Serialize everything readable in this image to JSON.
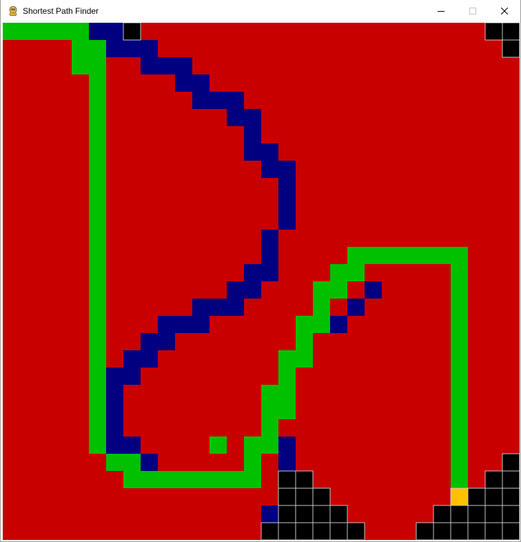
{
  "window": {
    "title": "Shortest Path Finder",
    "icon": "pygame-snake-icon",
    "controls": [
      "minimize-icon",
      "maximize-icon",
      "close-icon"
    ]
  },
  "colors": {
    "background": "#c80000",
    "path": "#00c000",
    "visited": "#000080",
    "wall": "#000000",
    "wall_outline": "#c8c8c8",
    "end": "#ffc000"
  },
  "grid": {
    "columns": 30,
    "rows": 30,
    "path": [
      [
        0,
        0
      ],
      [
        1,
        0
      ],
      [
        2,
        0
      ],
      [
        3,
        0
      ],
      [
        4,
        0
      ],
      [
        4,
        1
      ],
      [
        5,
        1
      ],
      [
        5,
        2
      ],
      [
        5,
        3
      ],
      [
        5,
        4
      ],
      [
        5,
        5
      ],
      [
        5,
        6
      ],
      [
        5,
        7
      ],
      [
        5,
        8
      ],
      [
        5,
        9
      ],
      [
        5,
        10
      ],
      [
        5,
        11
      ],
      [
        5,
        12
      ],
      [
        5,
        13
      ],
      [
        5,
        14
      ],
      [
        5,
        15
      ],
      [
        5,
        16
      ],
      [
        5,
        17
      ],
      [
        5,
        18
      ],
      [
        5,
        19
      ],
      [
        5,
        20
      ],
      [
        5,
        21
      ],
      [
        5,
        22
      ],
      [
        5,
        23
      ],
      [
        5,
        24
      ],
      [
        6,
        25
      ],
      [
        7,
        25
      ],
      [
        7,
        26
      ],
      [
        8,
        26
      ],
      [
        9,
        26
      ],
      [
        10,
        26
      ],
      [
        11,
        26
      ],
      [
        12,
        26
      ],
      [
        13,
        26
      ],
      [
        14,
        26
      ],
      [
        14,
        25
      ],
      [
        14,
        24
      ],
      [
        15,
        24
      ],
      [
        15,
        23
      ],
      [
        15,
        22
      ],
      [
        16,
        22
      ],
      [
        16,
        21
      ],
      [
        16,
        20
      ],
      [
        16,
        19
      ],
      [
        17,
        19
      ],
      [
        17,
        18
      ],
      [
        17,
        17
      ],
      [
        18,
        17
      ],
      [
        18,
        16
      ],
      [
        18,
        15
      ],
      [
        19,
        15
      ],
      [
        19,
        14
      ],
      [
        20,
        14
      ],
      [
        20,
        13
      ],
      [
        21,
        13
      ],
      [
        22,
        13
      ],
      [
        23,
        13
      ],
      [
        24,
        13
      ],
      [
        25,
        13
      ],
      [
        26,
        13
      ],
      [
        26,
        14
      ],
      [
        26,
        15
      ],
      [
        26,
        16
      ],
      [
        26,
        17
      ],
      [
        26,
        18
      ],
      [
        26,
        19
      ],
      [
        26,
        20
      ],
      [
        26,
        21
      ],
      [
        26,
        22
      ],
      [
        26,
        23
      ],
      [
        26,
        24
      ],
      [
        26,
        25
      ],
      [
        26,
        26
      ],
      [
        4,
        2
      ],
      [
        12,
        24
      ],
      [
        7,
        26
      ],
      [
        15,
        21
      ]
    ],
    "visited": [
      [
        5,
        0
      ],
      [
        6,
        0
      ],
      [
        6,
        1
      ],
      [
        7,
        1
      ],
      [
        8,
        1
      ],
      [
        8,
        2
      ],
      [
        9,
        2
      ],
      [
        10,
        2
      ],
      [
        10,
        3
      ],
      [
        11,
        3
      ],
      [
        11,
        4
      ],
      [
        12,
        4
      ],
      [
        13,
        4
      ],
      [
        13,
        5
      ],
      [
        14,
        5
      ],
      [
        14,
        6
      ],
      [
        14,
        7
      ],
      [
        15,
        7
      ],
      [
        15,
        8
      ],
      [
        16,
        8
      ],
      [
        16,
        9
      ],
      [
        16,
        10
      ],
      [
        16,
        11
      ],
      [
        15,
        12
      ],
      [
        15,
        13
      ],
      [
        15,
        14
      ],
      [
        14,
        14
      ],
      [
        14,
        15
      ],
      [
        13,
        15
      ],
      [
        13,
        16
      ],
      [
        12,
        16
      ],
      [
        11,
        16
      ],
      [
        11,
        17
      ],
      [
        10,
        17
      ],
      [
        9,
        17
      ],
      [
        9,
        18
      ],
      [
        8,
        18
      ],
      [
        8,
        19
      ],
      [
        7,
        19
      ],
      [
        7,
        20
      ],
      [
        6,
        20
      ],
      [
        6,
        21
      ],
      [
        6,
        22
      ],
      [
        6,
        23
      ],
      [
        6,
        24
      ],
      [
        7,
        24
      ],
      [
        7,
        25
      ],
      [
        8,
        25
      ],
      [
        8,
        26
      ],
      [
        9,
        26
      ],
      [
        16,
        24
      ],
      [
        16,
        25
      ],
      [
        16,
        26
      ],
      [
        16,
        27
      ],
      [
        16,
        28
      ],
      [
        15,
        28
      ],
      [
        15,
        29
      ],
      [
        17,
        23
      ],
      [
        17,
        24
      ],
      [
        17,
        25
      ],
      [
        17,
        26
      ],
      [
        18,
        22
      ],
      [
        18,
        23
      ],
      [
        18,
        24
      ],
      [
        18,
        25
      ],
      [
        18,
        26
      ],
      [
        18,
        27
      ],
      [
        19,
        21
      ],
      [
        19,
        22
      ],
      [
        19,
        23
      ],
      [
        19,
        24
      ],
      [
        19,
        25
      ],
      [
        19,
        26
      ],
      [
        19,
        27
      ],
      [
        19,
        28
      ],
      [
        20,
        20
      ],
      [
        20,
        21
      ],
      [
        20,
        22
      ],
      [
        20,
        23
      ],
      [
        20,
        24
      ],
      [
        20,
        25
      ],
      [
        20,
        26
      ],
      [
        20,
        27
      ],
      [
        20,
        28
      ],
      [
        20,
        29
      ],
      [
        21,
        15
      ],
      [
        21,
        16
      ],
      [
        21,
        17
      ],
      [
        21,
        18
      ],
      [
        21,
        19
      ],
      [
        21,
        20
      ],
      [
        21,
        21
      ],
      [
        21,
        22
      ],
      [
        21,
        23
      ],
      [
        21,
        24
      ],
      [
        21,
        25
      ],
      [
        21,
        26
      ],
      [
        21,
        27
      ],
      [
        21,
        28
      ],
      [
        21,
        29
      ],
      [
        22,
        15
      ],
      [
        22,
        16
      ],
      [
        22,
        17
      ],
      [
        22,
        18
      ],
      [
        22,
        19
      ],
      [
        22,
        20
      ],
      [
        22,
        21
      ],
      [
        22,
        22
      ],
      [
        22,
        23
      ],
      [
        22,
        24
      ],
      [
        22,
        25
      ],
      [
        22,
        26
      ],
      [
        22,
        27
      ],
      [
        22,
        28
      ],
      [
        22,
        29
      ],
      [
        23,
        14
      ],
      [
        23,
        15
      ],
      [
        23,
        16
      ],
      [
        23,
        17
      ],
      [
        23,
        18
      ],
      [
        23,
        19
      ],
      [
        23,
        20
      ],
      [
        23,
        21
      ],
      [
        23,
        22
      ],
      [
        23,
        23
      ],
      [
        23,
        24
      ],
      [
        23,
        25
      ],
      [
        23,
        26
      ],
      [
        23,
        27
      ],
      [
        23,
        28
      ],
      [
        23,
        29
      ],
      [
        24,
        14
      ],
      [
        24,
        15
      ],
      [
        24,
        16
      ],
      [
        24,
        17
      ],
      [
        24,
        18
      ],
      [
        24,
        19
      ],
      [
        24,
        20
      ],
      [
        24,
        21
      ],
      [
        24,
        22
      ],
      [
        24,
        23
      ],
      [
        24,
        24
      ],
      [
        24,
        25
      ],
      [
        24,
        26
      ],
      [
        24,
        27
      ],
      [
        24,
        28
      ],
      [
        24,
        29
      ],
      [
        25,
        14
      ],
      [
        25,
        15
      ],
      [
        25,
        16
      ],
      [
        25,
        17
      ],
      [
        25,
        18
      ],
      [
        25,
        19
      ],
      [
        25,
        20
      ],
      [
        25,
        21
      ],
      [
        25,
        22
      ],
      [
        25,
        23
      ],
      [
        25,
        24
      ],
      [
        25,
        25
      ],
      [
        25,
        26
      ],
      [
        25,
        27
      ],
      [
        25,
        28
      ],
      [
        25,
        29
      ]
    ],
    "visited_trim": [
      [
        21,
        15
      ],
      [
        21,
        16
      ],
      [
        21,
        17
      ],
      [
        21,
        18
      ],
      [
        21,
        19
      ],
      [
        21,
        20
      ],
      [
        21,
        21
      ],
      [
        21,
        22
      ],
      [
        21,
        23
      ],
      [
        21,
        24
      ],
      [
        21,
        25
      ],
      [
        21,
        26
      ],
      [
        21,
        27
      ],
      [
        21,
        28
      ],
      [
        21,
        29
      ],
      [
        22,
        15
      ],
      [
        22,
        16
      ],
      [
        22,
        17
      ],
      [
        22,
        18
      ],
      [
        22,
        19
      ],
      [
        22,
        20
      ],
      [
        22,
        21
      ],
      [
        22,
        22
      ],
      [
        22,
        23
      ],
      [
        22,
        24
      ],
      [
        22,
        25
      ],
      [
        22,
        26
      ],
      [
        22,
        27
      ],
      [
        22,
        28
      ],
      [
        22,
        29
      ],
      [
        23,
        14
      ],
      [
        23,
        15
      ],
      [
        23,
        16
      ],
      [
        23,
        17
      ],
      [
        23,
        18
      ],
      [
        23,
        19
      ],
      [
        23,
        20
      ],
      [
        23,
        21
      ],
      [
        23,
        22
      ],
      [
        23,
        23
      ],
      [
        23,
        24
      ],
      [
        23,
        25
      ],
      [
        23,
        26
      ],
      [
        23,
        27
      ],
      [
        23,
        28
      ],
      [
        23,
        29
      ],
      [
        24,
        14
      ],
      [
        24,
        15
      ],
      [
        24,
        16
      ],
      [
        24,
        17
      ],
      [
        24,
        18
      ],
      [
        24,
        19
      ],
      [
        24,
        20
      ],
      [
        24,
        21
      ],
      [
        24,
        22
      ],
      [
        24,
        23
      ],
      [
        24,
        24
      ],
      [
        24,
        25
      ],
      [
        24,
        26
      ],
      [
        24,
        27
      ],
      [
        24,
        28
      ],
      [
        24,
        29
      ],
      [
        25,
        14
      ],
      [
        25,
        15
      ],
      [
        25,
        16
      ],
      [
        25,
        17
      ],
      [
        25,
        18
      ],
      [
        25,
        19
      ],
      [
        25,
        20
      ],
      [
        25,
        21
      ],
      [
        25,
        22
      ],
      [
        25,
        23
      ],
      [
        25,
        24
      ],
      [
        25,
        25
      ],
      [
        25,
        26
      ],
      [
        25,
        27
      ],
      [
        25,
        28
      ],
      [
        25,
        29
      ],
      [
        18,
        22
      ],
      [
        18,
        23
      ],
      [
        18,
        24
      ],
      [
        18,
        25
      ],
      [
        18,
        26
      ],
      [
        18,
        27
      ],
      [
        19,
        21
      ],
      [
        19,
        22
      ],
      [
        19,
        23
      ],
      [
        19,
        24
      ],
      [
        19,
        25
      ],
      [
        19,
        26
      ],
      [
        19,
        27
      ],
      [
        19,
        28
      ],
      [
        20,
        20
      ],
      [
        20,
        21
      ],
      [
        20,
        22
      ],
      [
        20,
        23
      ],
      [
        20,
        24
      ],
      [
        20,
        25
      ],
      [
        20,
        26
      ],
      [
        20,
        27
      ],
      [
        20,
        28
      ],
      [
        20,
        29
      ],
      [
        17,
        23
      ],
      [
        17,
        24
      ],
      [
        17,
        25
      ],
      [
        17,
        26
      ]
    ],
    "visited_diag": [
      [
        19,
        17
      ],
      [
        20,
        16
      ],
      [
        21,
        15
      ]
    ],
    "walls": [
      [
        7,
        0
      ],
      [
        28,
        0
      ],
      [
        29,
        0
      ],
      [
        29,
        1
      ],
      [
        16,
        26
      ],
      [
        17,
        26
      ],
      [
        16,
        27
      ],
      [
        17,
        27
      ],
      [
        18,
        27
      ],
      [
        16,
        28
      ],
      [
        17,
        28
      ],
      [
        18,
        28
      ],
      [
        19,
        28
      ],
      [
        15,
        29
      ],
      [
        16,
        29
      ],
      [
        17,
        29
      ],
      [
        18,
        29
      ],
      [
        19,
        29
      ],
      [
        20,
        29
      ],
      [
        29,
        25
      ],
      [
        28,
        26
      ],
      [
        29,
        26
      ],
      [
        27,
        27
      ],
      [
        28,
        27
      ],
      [
        29,
        27
      ],
      [
        25,
        28
      ],
      [
        26,
        28
      ],
      [
        27,
        28
      ],
      [
        28,
        28
      ],
      [
        29,
        28
      ],
      [
        24,
        29
      ],
      [
        25,
        29
      ],
      [
        26,
        29
      ],
      [
        27,
        29
      ],
      [
        28,
        29
      ],
      [
        29,
        29
      ]
    ],
    "end": [
      26,
      27
    ]
  }
}
